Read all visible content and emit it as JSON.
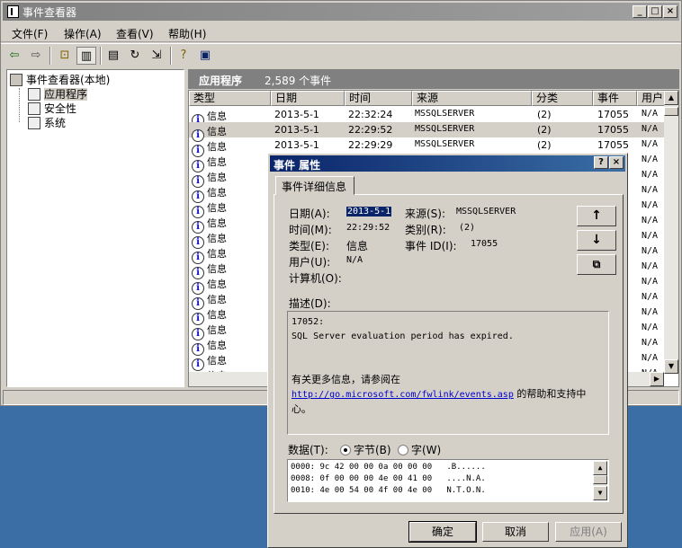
{
  "window": {
    "title": "事件查看器"
  },
  "menu": [
    "文件(F)",
    "操作(A)",
    "查看(V)",
    "帮助(H)"
  ],
  "toolbar_icons": [
    "back-icon",
    "forward-icon",
    "up-folder-icon",
    "show-hide-tree-icon",
    "properties-icon",
    "refresh-icon",
    "export-list-icon",
    "help-icon",
    "view-icon"
  ],
  "tree": {
    "root": "事件查看器(本地)",
    "items": [
      "应用程序",
      "安全性",
      "系统"
    ]
  },
  "panel": {
    "title": "应用程序",
    "count": "2,589 个事件"
  },
  "columns": [
    "类型",
    "日期",
    "时间",
    "来源",
    "分类",
    "事件",
    "用户"
  ],
  "rows": [
    {
      "type": "信息",
      "date": "2013-5-1",
      "time": "22:32:24",
      "source": "MSSQLSERVER",
      "category": "(2)",
      "event": "17055",
      "user": "N/A"
    },
    {
      "type": "信息",
      "date": "2013-5-1",
      "time": "22:29:52",
      "source": "MSSQLSERVER",
      "category": "(2)",
      "event": "17055",
      "user": "N/A"
    },
    {
      "type": "信息",
      "date": "2013-5-1",
      "time": "22:29:29",
      "source": "MSSQLSERVER",
      "category": "(2)",
      "event": "17055",
      "user": "N/A"
    },
    {
      "type": "信息",
      "user": "N/A"
    },
    {
      "type": "信息",
      "user": "N/A"
    },
    {
      "type": "信息",
      "user": "N/A"
    },
    {
      "type": "信息",
      "user": "N/A"
    },
    {
      "type": "信息",
      "user": "N/A"
    },
    {
      "type": "信息",
      "user": "N/A"
    },
    {
      "type": "信息",
      "user": "N/A"
    },
    {
      "type": "信息",
      "user": "N/A"
    },
    {
      "type": "信息",
      "user": "N/A"
    },
    {
      "type": "信息",
      "user": "N/A"
    },
    {
      "type": "信息",
      "user": "N/A"
    },
    {
      "type": "信息",
      "user": "N/A"
    },
    {
      "type": "信息",
      "user": "N/A"
    },
    {
      "type": "信息",
      "user": "N/A"
    },
    {
      "type": "信息",
      "user": "N/A"
    },
    {
      "type": "信息",
      "user": "N/A"
    }
  ],
  "dialog": {
    "title": "事件 属性",
    "tab": "事件详细信息",
    "labels": {
      "date": "日期(A):",
      "source": "来源(S):",
      "time": "时间(M):",
      "category": "类别(R):",
      "type": "类型(E):",
      "event_id": "事件 ID(I):",
      "user": "用户(U):",
      "computer": "计算机(O):",
      "description": "描述(D):",
      "data": "数据(T):",
      "bytes": "字节(B)",
      "words": "字(W)"
    },
    "values": {
      "date": "2013-5-1",
      "source": "MSSQLSERVER",
      "time": "22:29:52",
      "category": "(2)",
      "type": "信息",
      "event_id": "17055",
      "user": "N/A",
      "computer": ""
    },
    "description": {
      "line1": "17052:",
      "line2": "SQL Server evaluation period has expired.",
      "line3": "有关更多信息，请参阅在",
      "link": "http://go.microsoft.com/fwlink/events.asp",
      "line4_suffix": " 的帮助和支持中",
      "line5": "心。"
    },
    "data_radio_selected": "bytes",
    "hex_lines": [
      "0000: 9c 42 00 00 0a 00 00 00   .B......",
      "0008: 0f 00 00 00 4e 00 41 00   ....N.A.",
      "0010: 4e 00 54 00 4f 00 4e 00   N.T.O.N."
    ],
    "buttons": {
      "ok": "确定",
      "cancel": "取消",
      "apply": "应用(A)"
    }
  }
}
